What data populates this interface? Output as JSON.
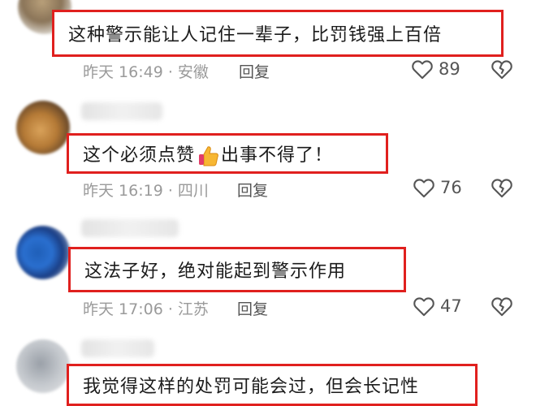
{
  "comments": [
    {
      "text": "这种警示能让人记住一辈子，比罚钱强上百倍",
      "meta": "昨天 16:49 · 安徽",
      "reply": "回复",
      "likes": "89",
      "heart_icon": "heart-outline-icon",
      "dislike_icon": "broken-heart-icon"
    },
    {
      "text_before": "这个必须点赞",
      "emoji": "thumbs-up-icon",
      "text_after": "出事不得了！",
      "meta": "昨天 16:19 · 四川",
      "reply": "回复",
      "likes": "76",
      "heart_icon": "heart-outline-icon",
      "dislike_icon": "broken-heart-icon"
    },
    {
      "text": "这法子好，绝对能起到警示作用",
      "meta": "昨天 17:06 · 江苏",
      "reply": "回复",
      "likes": "47",
      "heart_icon": "heart-outline-icon",
      "dislike_icon": "broken-heart-icon"
    },
    {
      "text": "我觉得这样的处罚可能会过，但会长记性"
    }
  ],
  "colors": {
    "highlight_border": "#e0201e",
    "meta_text": "#9a9a9a",
    "body_text": "#1b1b1b"
  }
}
